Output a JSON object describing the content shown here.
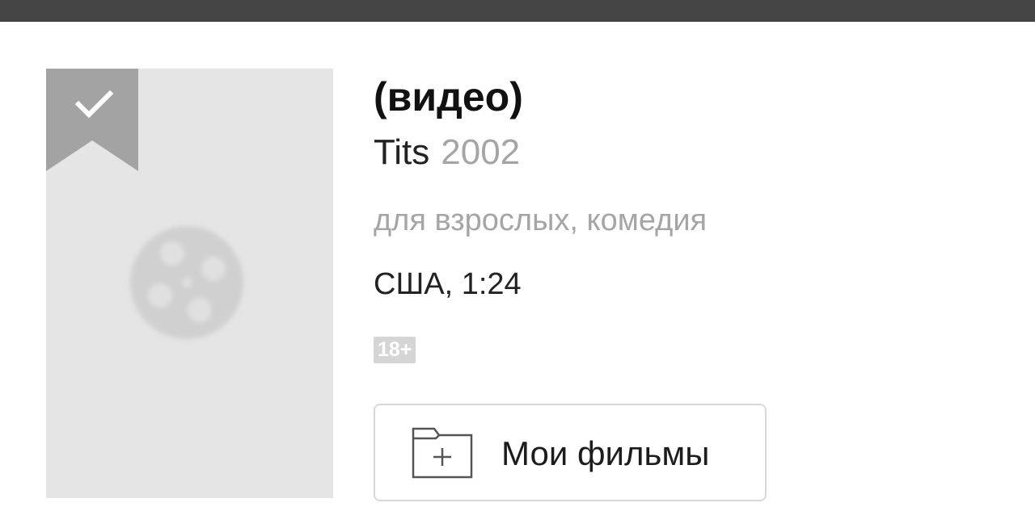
{
  "header": {},
  "poster": {
    "placeholder_icon": "film-reel-icon",
    "bookmark_icon": "checkmark-icon",
    "bookmark_checked": true
  },
  "movie": {
    "title": "(видео)",
    "original_title": "Tits",
    "year": "2002",
    "genres": "для взрослых, комедия",
    "country_duration": "США, 1:24",
    "age_rating": "18+"
  },
  "actions": {
    "my_movies_label": "Мои фильмы",
    "my_movies_icon": "folder-plus-icon"
  },
  "colors": {
    "topbar": "#454545",
    "poster_bg": "#e5e5e5",
    "bookmark": "#a3a3a3",
    "muted_text": "#a5a5a5",
    "age_badge": "#d5d5d5",
    "button_border": "#d8d8d8"
  }
}
